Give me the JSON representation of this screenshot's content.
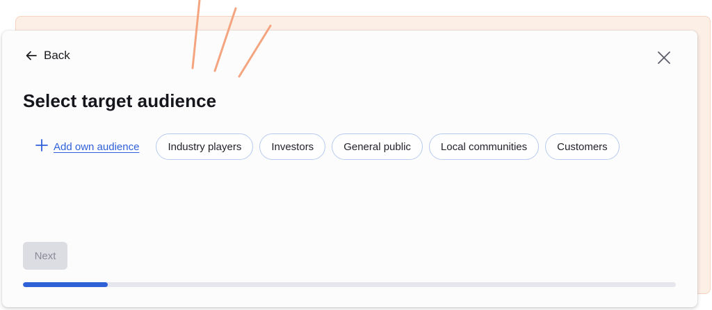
{
  "header": {
    "back_label": "Back",
    "back_icon": "arrow-left-icon",
    "close_icon": "close-icon"
  },
  "title": "Select target audience",
  "add_own": {
    "label": "Add own audience",
    "icon": "plus-icon"
  },
  "audiences": [
    {
      "label": "Industry players"
    },
    {
      "label": "Investors"
    },
    {
      "label": "General public"
    },
    {
      "label": "Local communities"
    },
    {
      "label": "Customers"
    }
  ],
  "footer": {
    "next_label": "Next",
    "next_enabled": false,
    "progress": 0.13
  },
  "colors": {
    "accent": "#2f61d6",
    "chip_border": "#b7cbee",
    "decor_stroke": "#f4a580",
    "back_card": "#fcefe6"
  }
}
